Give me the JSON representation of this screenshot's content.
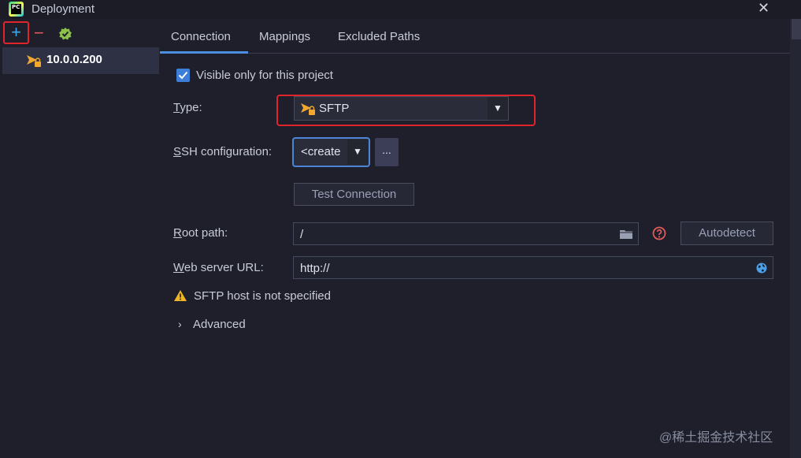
{
  "window": {
    "title": "Deployment",
    "close_glyph": "✕",
    "app_icon_text": "PC"
  },
  "toolbar": {
    "add_glyph": "+",
    "remove_glyph": "−",
    "default_icon": "check-badge-icon"
  },
  "servers": [
    {
      "label": "10.0.0.200",
      "icon": "sftp-icon",
      "selected": true
    }
  ],
  "tabs": [
    {
      "label": "Connection",
      "active": true
    },
    {
      "label": "Mappings",
      "active": false
    },
    {
      "label": "Excluded Paths",
      "active": false
    }
  ],
  "connection": {
    "visible_only_label": "Visible only for this project",
    "visible_only_checked": true,
    "type_label_first": "T",
    "type_label_rest": "ype:",
    "type_value": "SFTP",
    "ssh_label_first": "S",
    "ssh_label_rest": "SH configuration:",
    "ssh_value": "<create",
    "ellipsis": "...",
    "test_connection": "Test Connection",
    "root_path_label_first": "R",
    "root_path_label_rest": "oot path:",
    "root_path_value": "/",
    "autodetect": "Autodetect",
    "web_url_label_first": "W",
    "web_url_label_rest": "eb server URL:",
    "web_url_value": "http://",
    "warning": "SFTP host is not specified",
    "advanced_chevron": "›",
    "advanced_label": "Advanced"
  },
  "watermark": "@稀土掘金技术社区",
  "colors": {
    "accent": "#4a8fe0",
    "highlight_red": "#e0242c",
    "selected_row": "#2e3144",
    "warning_yellow": "#f0b429"
  }
}
